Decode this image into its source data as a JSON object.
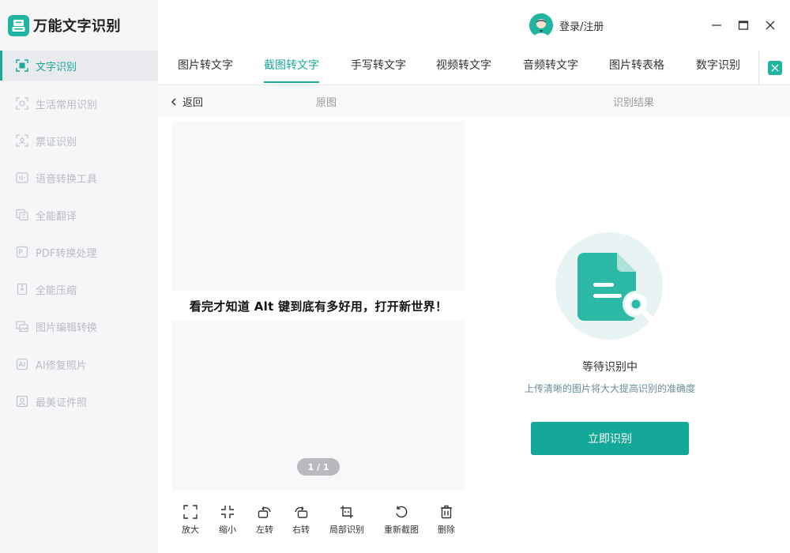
{
  "app": {
    "title": "万能文字识别",
    "accent_color": "#1ba899"
  },
  "header": {
    "login_label": "登录/注册",
    "window_controls": [
      "minimize-icon",
      "maximize-icon",
      "close-icon"
    ]
  },
  "sidebar": {
    "items": [
      {
        "label": "文字识别",
        "icon": "text-scan-icon",
        "active": true
      },
      {
        "label": "生活常用识别",
        "icon": "scan-icon",
        "active": false
      },
      {
        "label": "票证识别",
        "icon": "id-scan-icon",
        "active": false
      },
      {
        "label": "语音转换工具",
        "icon": "voice-icon",
        "active": false
      },
      {
        "label": "全能翻译",
        "icon": "translate-icon",
        "active": false
      },
      {
        "label": "PDF转换处理",
        "icon": "pdf-icon",
        "active": false
      },
      {
        "label": "全能压缩",
        "icon": "compress-icon",
        "active": false
      },
      {
        "label": "图片编辑转换",
        "icon": "image-edit-icon",
        "active": false
      },
      {
        "label": "AI修复照片",
        "icon": "ai-photo-icon",
        "active": false
      },
      {
        "label": "最美证件照",
        "icon": "id-photo-icon",
        "active": false
      }
    ]
  },
  "tabs": [
    {
      "label": "图片转文字",
      "active": false
    },
    {
      "label": "截图转文字",
      "active": true
    },
    {
      "label": "手写转文字",
      "active": false
    },
    {
      "label": "视频转文字",
      "active": false
    },
    {
      "label": "音频转文字",
      "active": false
    },
    {
      "label": "图片转表格",
      "active": false
    },
    {
      "label": "数字识别",
      "active": false
    }
  ],
  "subheader": {
    "back_label": "返回",
    "original_label": "原图",
    "result_label": "识别结果"
  },
  "preview": {
    "image_text": "看完才知道 Alt 键到底有多好用，打开新世界！",
    "page_indicator": "1 / 1"
  },
  "toolbar": [
    {
      "label": "放大",
      "icon": "zoom-in-icon"
    },
    {
      "label": "缩小",
      "icon": "zoom-out-icon"
    },
    {
      "label": "左转",
      "icon": "rotate-left-icon"
    },
    {
      "label": "右转",
      "icon": "rotate-right-icon"
    },
    {
      "label": "局部识别",
      "icon": "crop-icon"
    },
    {
      "label": "重新截图",
      "icon": "recapture-icon"
    },
    {
      "label": "删除",
      "icon": "trash-icon"
    }
  ],
  "result": {
    "status_title": "等待识别中",
    "status_desc": "上传清晰的图片将大大提高识别的准确度",
    "button_label": "立即识别"
  }
}
